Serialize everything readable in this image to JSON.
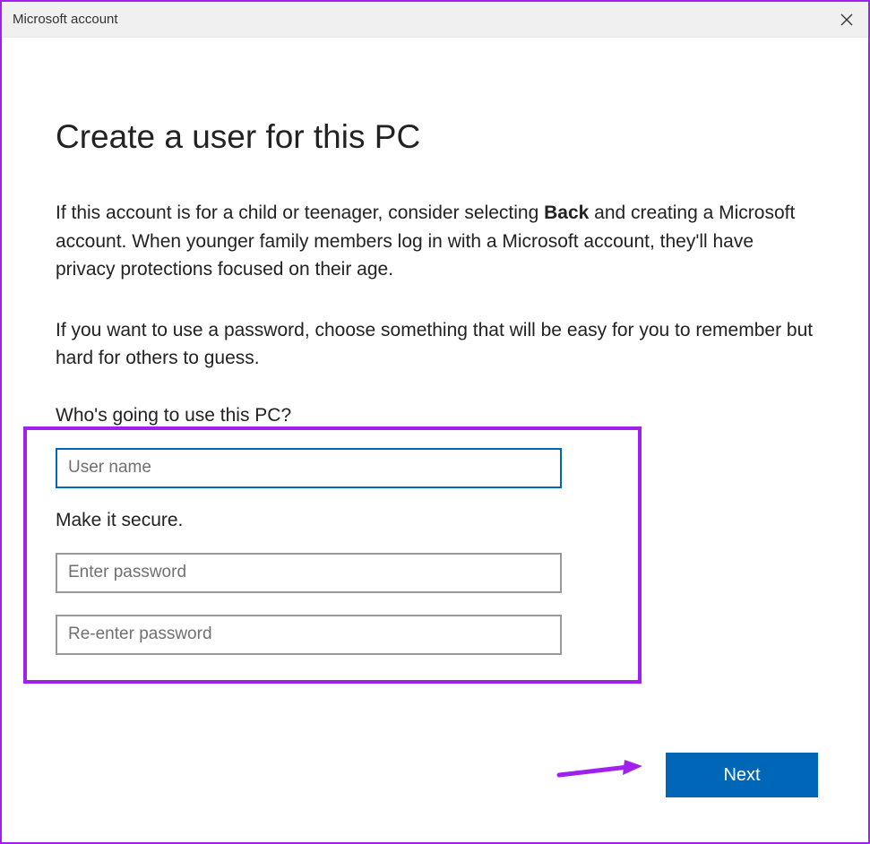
{
  "titlebar": {
    "title": "Microsoft account"
  },
  "heading": "Create a user for this PC",
  "description": {
    "pre": "If this account is for a child or teenager, consider selecting ",
    "bold": "Back",
    "post": " and creating a Microsoft account. When younger family members log in with a Microsoft account, they'll have privacy protections focused on their age."
  },
  "sub_description": "If you want to use a password, choose something that will be easy for you to remember but hard for others to guess.",
  "form": {
    "who_label": "Who's going to use this PC?",
    "username_placeholder": "User name",
    "username_value": "",
    "secure_label": "Make it secure.",
    "password_placeholder": "Enter password",
    "password_value": "",
    "reenter_placeholder": "Re-enter password",
    "reenter_value": ""
  },
  "footer": {
    "next_label": "Next"
  }
}
